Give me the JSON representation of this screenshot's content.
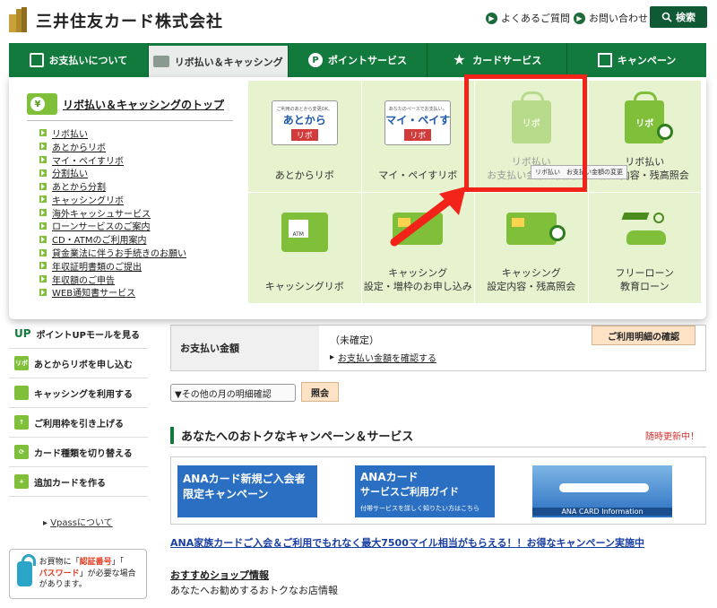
{
  "header": {
    "company_name": "三井住友カード株式会社",
    "faq_label": "よくあるご質問",
    "contact_label": "お問い合わせ",
    "search_label": "検索"
  },
  "nav": {
    "items": [
      {
        "label": "お支払いについて",
        "icon": "calculator-icon"
      },
      {
        "label": "リボ払い＆キャッシング",
        "icon": "card-yen-icon"
      },
      {
        "label": "ポイントサービス",
        "icon": "p-circle-icon"
      },
      {
        "label": "カードサービス",
        "icon": "star-icon"
      },
      {
        "label": "キャンペーン",
        "icon": "gift-icon"
      }
    ],
    "active_index": 1
  },
  "dropdown": {
    "top_link": "リボ払い＆キャッシングのトップ",
    "links": [
      "リボ払い",
      "あとからリボ",
      "マイ・ペイすリボ",
      "分割払い",
      "あとから分割",
      "キャッシングリボ",
      "海外キャッシュサービス",
      "ローンサービスのご案内",
      "CD・ATMのご利用案内",
      "貸金業法に伴うお手続きのお願い",
      "年収証明書類のご提出",
      "年収額のご申告",
      "WEB通知書サービス"
    ],
    "tiles": [
      {
        "label_1": "あとからリボ",
        "label_2": "",
        "art_sub": "ご利用のあとから変更OK。",
        "art_main": "あとから",
        "art_tag": "リボ"
      },
      {
        "label_1": "マイ・ペイすリボ",
        "label_2": "",
        "art_sub": "あなたのペースでお支払い。",
        "art_main": "マイ・ペイす",
        "art_tag": "リボ"
      },
      {
        "label_1": "リボ払い",
        "label_2": "お支払い金額の変更",
        "art_text": "リボ"
      },
      {
        "label_1": "リボ払い",
        "label_2": "設定内容・残高照会",
        "art_text": "リボ"
      },
      {
        "label_1": "キャッシングリボ",
        "label_2": ""
      },
      {
        "label_1": "キャッシング",
        "label_2": "設定・増枠のお申し込み"
      },
      {
        "label_1": "キャッシング",
        "label_2": "設定内容・残高照会"
      },
      {
        "label_1": "フリーローン",
        "label_2": "教育ローン"
      }
    ],
    "tooltip": "リボ払い　お支払い金額の変更"
  },
  "sidebar": {
    "items": [
      {
        "label": "ポイントUPモールを見る",
        "icon": "up-icon",
        "icon_text": "UP"
      },
      {
        "label": "あとからリボを申し込む",
        "icon": "ribo-icon",
        "icon_text": "リボ"
      },
      {
        "label": "キャッシングを利用する",
        "icon": "cash-icon",
        "icon_text": ""
      },
      {
        "label": "ご利用枠を引き上げる",
        "icon": "limit-up-icon",
        "icon_text": ""
      },
      {
        "label": "カード種類を切り替える",
        "icon": "switch-icon",
        "icon_text": ""
      },
      {
        "label": "追加カードを作る",
        "icon": "add-card-icon",
        "icon_text": ""
      }
    ],
    "vpass_link": "Vpassについて",
    "notice": {
      "pre": "お買物に「",
      "code": "認証番号",
      "mid": "」「",
      "password": "パスワード",
      "post": "」が必要な場合があります。"
    }
  },
  "main": {
    "payment_header": "お支払い金額",
    "payment_status": "（未確定）",
    "payment_link": "お支払い金額を確認する",
    "detail_button": "ご利用明細の確認",
    "month_select": "▼その他の月の明細確認",
    "go_button": "照会",
    "section_title": "あなたへのおトクなキャンペーン＆サービス",
    "section_note": "随時更新中！",
    "banners": [
      {
        "line_1": "ANAカード新規ご入会者",
        "line_2": "限定キャンペーン"
      },
      {
        "line_1": "ANAカード",
        "line_2": "サービスご利用ガイド",
        "line_3": "付帯サービスを詳しく知りたい方はこちら"
      },
      {
        "line_1": "ANA CARD Information"
      }
    ],
    "ana_link": "ANA家族カードご入会＆ご利用でもれなく最大7500マイル相当がもらえる！！お得なキャンペーン実施中",
    "shop_title": "おすすめショップ情報",
    "shop_desc": "あなたへお勧めするおトクなお店情報"
  }
}
